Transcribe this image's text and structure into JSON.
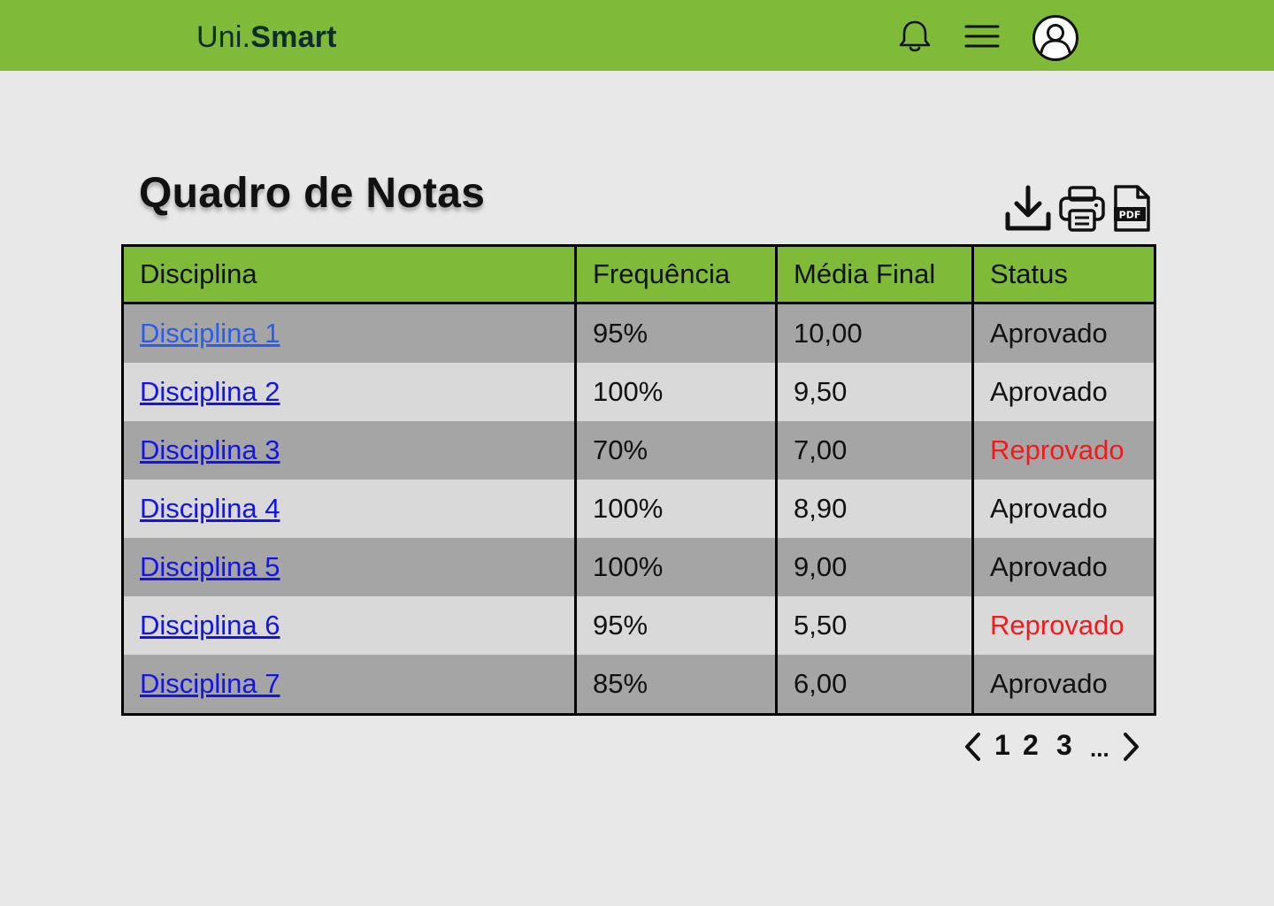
{
  "header": {
    "logo_prefix": "Uni.",
    "logo_bold": "Smart",
    "icons": [
      "bell-icon",
      "menu-icon",
      "user-profile-icon"
    ]
  },
  "page": {
    "title": "Quadro de Notas",
    "actions": [
      "download-icon",
      "print-icon",
      "pdf-icon"
    ]
  },
  "table": {
    "headers": [
      "Disciplina",
      "Frequência",
      "Média Final",
      "Status"
    ],
    "rows": [
      {
        "disciplina": "Disciplina 1",
        "frequencia": "95%",
        "media": "10,00",
        "status": "Aprovado"
      },
      {
        "disciplina": "Disciplina 2",
        "frequencia": "100%",
        "media": "9,50",
        "status": "Aprovado"
      },
      {
        "disciplina": "Disciplina 3",
        "frequencia": "70%",
        "media": "7,00",
        "status": "Reprovado"
      },
      {
        "disciplina": "Disciplina 4",
        "frequencia": "100%",
        "media": "8,90",
        "status": "Aprovado"
      },
      {
        "disciplina": "Disciplina 5",
        "frequencia": "100%",
        "media": "9,00",
        "status": "Aprovado"
      },
      {
        "disciplina": "Disciplina 6",
        "frequencia": "95%",
        "media": "5,50",
        "status": "Reprovado"
      },
      {
        "disciplina": "Disciplina 7",
        "frequencia": "85%",
        "media": "6,00",
        "status": "Aprovado"
      }
    ]
  },
  "pagination": {
    "pages": [
      "1",
      "2",
      "3"
    ],
    "ellipsis": "...",
    "prev_icon": "chevron-left-icon",
    "next_icon": "chevron-right-icon"
  },
  "colors": {
    "brand_green": "#7fbb38",
    "background": "#e8e8e8",
    "row_dark": "#a5a5a5",
    "row_light": "#d9d9d9",
    "link": "#1414e6",
    "reprovado": "#f21a1a"
  }
}
